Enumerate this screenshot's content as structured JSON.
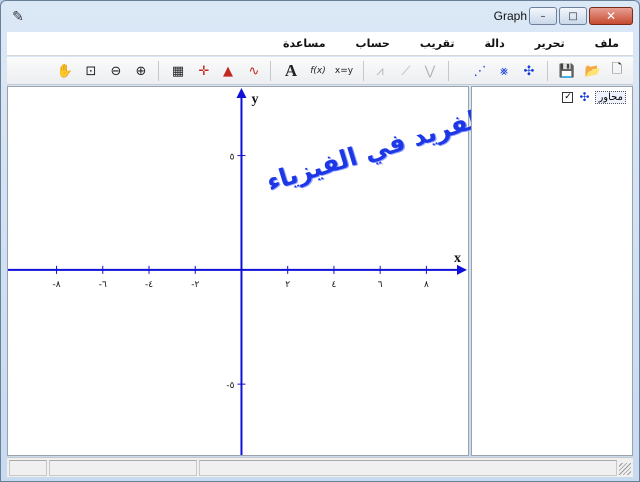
{
  "window": {
    "title": "Graph",
    "app_icon": "graph-app-icon"
  },
  "caption": {
    "minimize": "–",
    "maximize": "□",
    "close": "✕"
  },
  "menu": [
    "ملف",
    "تحرير",
    "دالة",
    "تقريب",
    "حساب",
    "مساعدة"
  ],
  "toolbar_icons": [
    "hand-pan-icon",
    "zoom-window-icon",
    "zoom-out-icon",
    "zoom-in-icon",
    "table-icon",
    "evaluate-icon",
    "area-icon",
    "curve-icon",
    "text-icon",
    "fx-icon",
    "xy-icon",
    "shade-disabled-icon",
    "tangent-disabled-icon",
    "normal-disabled-icon",
    "point-series-icon",
    "relation-icon",
    "axes-icon",
    "save-icon",
    "open-icon",
    "new-icon"
  ],
  "toolbar_text": {
    "text": "A",
    "fx": "f(x)",
    "xy": "x=y"
  },
  "graph": {
    "x_label": "x",
    "y_label": "y",
    "x_ticks": [
      {
        "value": -8,
        "label": "-٨"
      },
      {
        "value": -6,
        "label": "-٦"
      },
      {
        "value": -4,
        "label": "-٤"
      },
      {
        "value": -2,
        "label": "-٢"
      },
      {
        "value": 2,
        "label": "٢"
      },
      {
        "value": 4,
        "label": "٤"
      },
      {
        "value": 6,
        "label": "٦"
      },
      {
        "value": 8,
        "label": "٨"
      }
    ],
    "y_ticks": [
      {
        "value": 5,
        "label": "٥"
      },
      {
        "value": -5,
        "label": "-٥"
      }
    ],
    "x_range": [
      -10.1,
      9.8
    ],
    "y_range": [
      -8.1,
      8.0
    ],
    "axis_color": "#1010d8"
  },
  "watermark": "موقع الفريد في الفيزياء",
  "legend": {
    "item_label": "محاور",
    "checked": "✓"
  }
}
